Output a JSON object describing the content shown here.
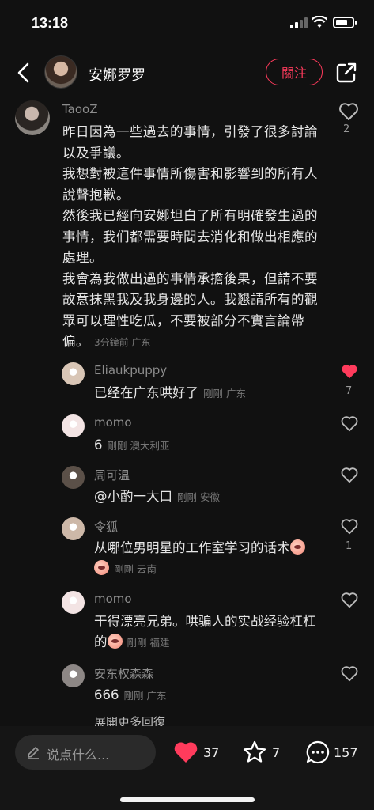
{
  "status_bar": {
    "time": "13:18"
  },
  "header": {
    "name": "安娜罗罗",
    "follow_label": "關注"
  },
  "main_comment": {
    "user": "TaooZ",
    "text": "昨日因為一些過去的事情，引發了很多討論以及爭議。\n我想對被這件事情所傷害和影響到的所有人說聲抱歉。\n然後我已經向安娜坦白了所有明確發生過的事情，我们都需要時間去消化和做出相應的處理。\n我會為我做出過的事情承擔後果，但請不要故意抹黑我及我身邊的人。我懇請所有的觀眾可以理性吃瓜，不要被部分不實言論帶偏。",
    "meta": "3分鐘前 广东",
    "like_count": "2"
  },
  "replies": [
    {
      "user": "Eliaukpuppy",
      "text": "已经在广东哄好了",
      "meta": "剛剛 广东",
      "liked": true,
      "like_count": "7"
    },
    {
      "user": "momo",
      "text": "6",
      "meta": "剛剛 澳大利亚",
      "liked": false,
      "like_count": ""
    },
    {
      "user": "周可温",
      "text": "@小酌一大口",
      "meta": "剛剛 安徽",
      "liked": false,
      "like_count": ""
    },
    {
      "user": "令狐",
      "text": "从哪位男明星的工作室学习的话术",
      "meta": "剛剛 云南",
      "liked": false,
      "like_count": "1"
    },
    {
      "user": "momo",
      "text": "干得漂亮兄弟。哄骗人的实战经验杠杠的",
      "meta": "剛剛 福建",
      "liked": false,
      "like_count": ""
    },
    {
      "user": "安东权森森",
      "text": "666",
      "meta": "剛剛 广东",
      "liked": false,
      "like_count": ""
    }
  ],
  "expand_more": "展開更多回復",
  "bottom_bar": {
    "input_placeholder": "说点什么...",
    "like_count": "37",
    "star_count": "7",
    "comment_count": "157"
  },
  "colors": {
    "accent": "#ff3b5c",
    "background": "#111111",
    "meta_text": "#777777"
  }
}
